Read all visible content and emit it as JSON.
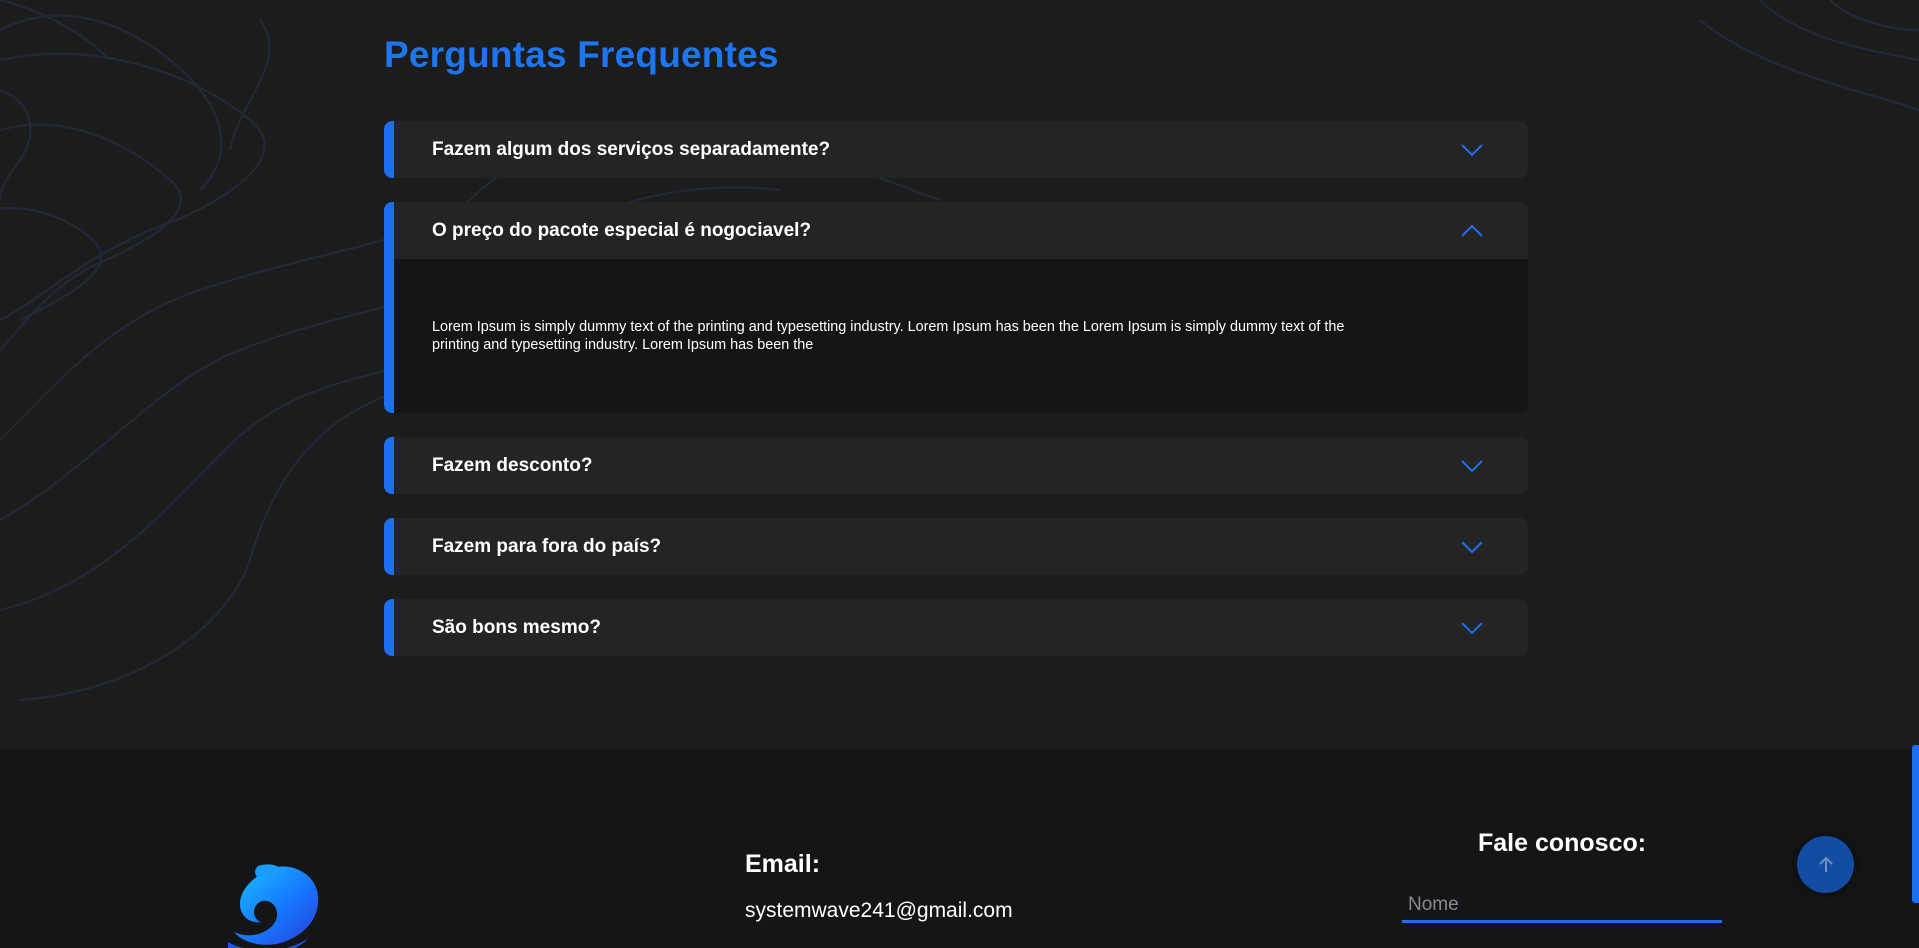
{
  "faq": {
    "title": "Perguntas Frequentes",
    "items": [
      {
        "question": "Fazem algum dos serviços separadamente?",
        "expanded": false,
        "icon": "chevron-down-icon"
      },
      {
        "question": "O preço do pacote especial é nogociavel?",
        "expanded": true,
        "icon": "chevron-up-icon",
        "answer": "Lorem Ipsum is simply dummy text of the printing and typesetting industry. Lorem Ipsum has been the Lorem Ipsum is simply dummy text of the printing and typesetting industry. Lorem Ipsum has been the"
      },
      {
        "question": "Fazem desconto?",
        "expanded": false,
        "icon": "chevron-down-icon"
      },
      {
        "question": "Fazem para fora do país?",
        "expanded": false,
        "icon": "chevron-down-icon"
      },
      {
        "question": "São bons mesmo?",
        "expanded": false,
        "icon": "chevron-down-icon"
      }
    ]
  },
  "footer": {
    "logo_icon": "wave-logo-icon",
    "email_label": "Email:",
    "email_value": "systemwave241@gmail.com",
    "contact_title": "Fale conosco:",
    "name_placeholder": "Nome"
  },
  "scroll_top": {
    "icon": "arrow-up-icon"
  },
  "colors": {
    "accent": "#1d6ff0",
    "title_blue": "#1d75f0",
    "background": "#1c1c1d",
    "card": "#242425",
    "answer_bg": "#151516",
    "footer_bg": "#141517"
  }
}
